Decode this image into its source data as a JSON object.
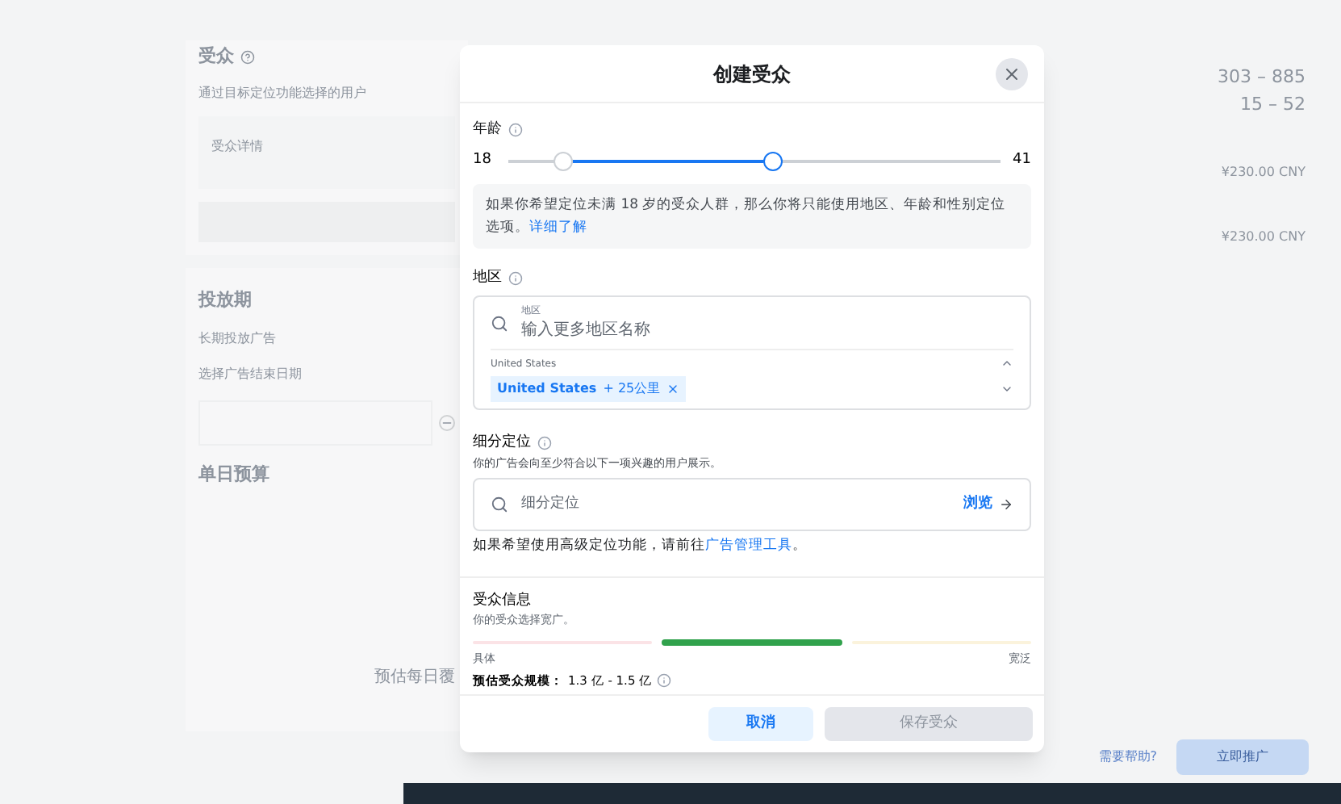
{
  "background": {
    "left_panel": {
      "audience_title": "受众",
      "audience_desc": "通过目标定位功能选择的用户",
      "audience_card_title": "受众详情",
      "schedule_title": "投放期",
      "schedule_option": "长期投放广告",
      "schedule_end": "选择广告结束日期",
      "budget_title": "单日预算",
      "estimate_label": "预估每日覆"
    },
    "right_values": [
      "303 – 885",
      "15 – 52",
      "¥230.00 CNY",
      "¥230.00 CNY"
    ],
    "footer": {
      "help": "需要帮助?",
      "promote_button": "立即推广"
    }
  },
  "dialog": {
    "title": "创建受众",
    "age": {
      "label": "年龄",
      "min": "18",
      "max": "41",
      "thumbs": [
        {
          "level": 0.11
        },
        {
          "level": 0.54
        }
      ]
    },
    "notice": {
      "text": "如果你希望定位未满 18 岁的受众人群，那么你将只能使用地区、年龄和性别定位选项。",
      "link": "详细了解"
    },
    "location": {
      "label": "地区",
      "field_label": "地区",
      "placeholder": "输入更多地区名称",
      "group": "United States",
      "chips": [
        {
          "name": "United States",
          "radius": "+ 25公里"
        }
      ]
    },
    "detailed": {
      "label": "细分定位",
      "desc": "你的广告会向至少符合以下一项兴趣的用户展示。",
      "placeholder": "细分定位",
      "browse": "浏览",
      "hint": "如果希望使用高级定位功能，请前往",
      "hint_link": "广告管理工具",
      "hint_end": "。"
    },
    "audience_info": {
      "title": "受众信息",
      "desc": "你的受众选择宽广。",
      "segments": [
        {
          "selected": false,
          "color": "#fbe3e6"
        },
        {
          "selected": true,
          "color": "#31a24c"
        },
        {
          "selected": false,
          "color": "#fbf3dc"
        }
      ],
      "left_label": "具体",
      "right_label": "宽泛",
      "estimate_label": "预估受众规模：",
      "estimate": "1.3 亿 - 1.5 亿"
    },
    "buttons": [
      {
        "label": "取消",
        "disabled": false
      },
      {
        "label": "保存受众",
        "disabled": true
      }
    ]
  }
}
